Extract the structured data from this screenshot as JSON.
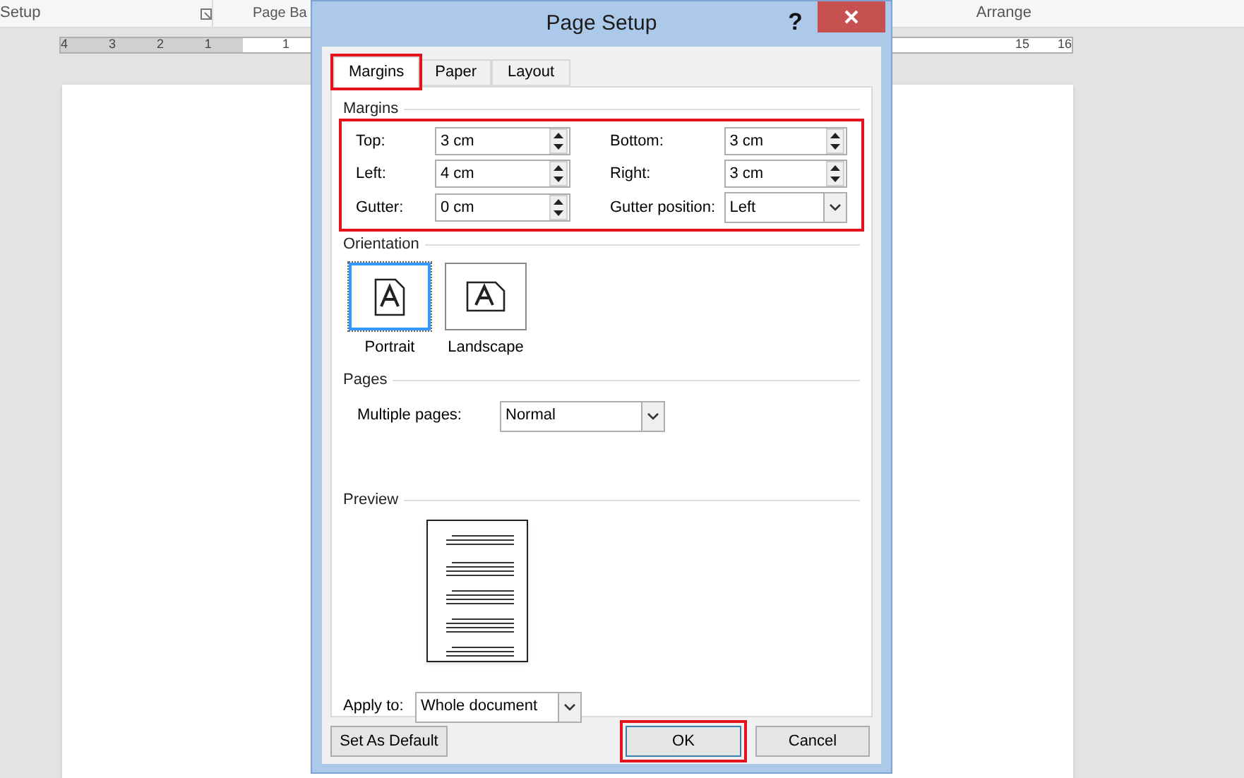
{
  "ribbon": {
    "groups": [
      "Setup",
      "Page Ba",
      "Arrange"
    ]
  },
  "ruler": {
    "left_numbers": [
      "4",
      "3",
      "2",
      "1",
      "1"
    ],
    "right_numbers": [
      "15",
      "16"
    ]
  },
  "dialog": {
    "title": "Page Setup",
    "help": "?",
    "tabs": [
      {
        "label": "Margins",
        "selected": true,
        "highlighted": true
      },
      {
        "label": "Paper",
        "selected": false,
        "highlighted": false
      },
      {
        "label": "Layout",
        "selected": false,
        "highlighted": false
      }
    ],
    "margins": {
      "heading": "Margins",
      "highlighted": true,
      "fields": [
        {
          "label": "Top:",
          "value": "3 cm",
          "kind": "spin"
        },
        {
          "label": "Bottom:",
          "value": "3 cm",
          "kind": "spin"
        },
        {
          "label": "Left:",
          "value": "4 cm",
          "kind": "spin"
        },
        {
          "label": "Right:",
          "value": "3 cm",
          "kind": "spin"
        },
        {
          "label": "Gutter:",
          "value": "0 cm",
          "kind": "spin"
        },
        {
          "label": "Gutter position:",
          "value": "Left",
          "kind": "select"
        }
      ]
    },
    "orientation": {
      "heading": "Orientation",
      "options": [
        {
          "label": "Portrait",
          "selected": true
        },
        {
          "label": "Landscape",
          "selected": false
        }
      ]
    },
    "pages": {
      "heading": "Pages",
      "label": "Multiple pages:",
      "value": "Normal"
    },
    "preview": {
      "heading": "Preview"
    },
    "apply_to": {
      "label": "Apply to:",
      "value": "Whole document"
    },
    "buttons": [
      {
        "label": "Set As Default",
        "highlighted": false
      },
      {
        "label": "OK",
        "highlighted": true
      },
      {
        "label": "Cancel",
        "highlighted": false
      }
    ]
  }
}
